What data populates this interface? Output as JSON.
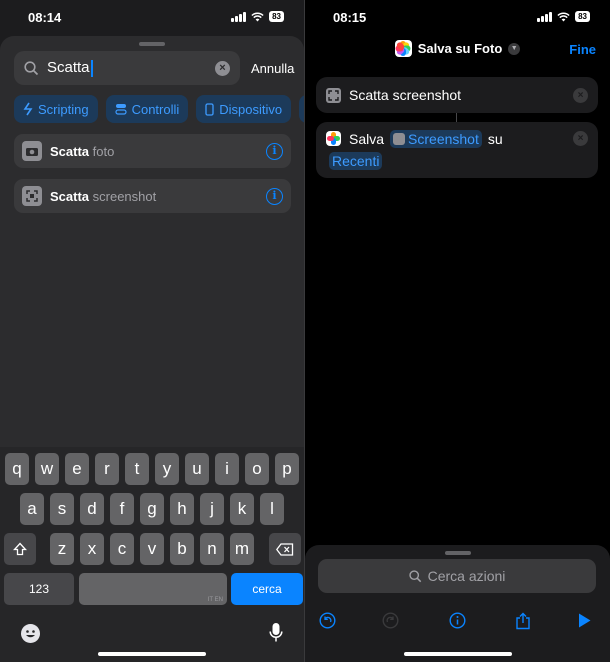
{
  "left": {
    "status": {
      "time": "08:14",
      "battery": "83"
    },
    "search": {
      "value": "Scatta",
      "cancel": "Annulla"
    },
    "chips": [
      {
        "label": "Scripting",
        "icon": "scripting-icon"
      },
      {
        "label": "Controlli",
        "icon": "controls-icon"
      },
      {
        "label": "Dispositivo",
        "icon": "device-icon"
      }
    ],
    "results": [
      {
        "bold": "Scatta",
        "rest": " foto",
        "icon": "camera-icon"
      },
      {
        "bold": "Scatta",
        "rest": " screenshot",
        "icon": "screenshot-icon"
      }
    ],
    "keyboard": {
      "row1": [
        "q",
        "w",
        "e",
        "r",
        "t",
        "y",
        "u",
        "i",
        "o",
        "p"
      ],
      "row2": [
        "a",
        "s",
        "d",
        "f",
        "g",
        "h",
        "j",
        "k",
        "l"
      ],
      "row3": [
        "z",
        "x",
        "c",
        "v",
        "b",
        "n",
        "m"
      ],
      "numbers": "123",
      "search_key": "cerca",
      "space_hint": "IT EN"
    }
  },
  "right": {
    "status": {
      "time": "08:15",
      "battery": "83"
    },
    "nav": {
      "title": "Salva su Foto",
      "done": "Fine"
    },
    "action1": {
      "title": "Scatta screenshot"
    },
    "action2": {
      "verb": "Salva",
      "variable": "Screenshot",
      "preposition": "su",
      "album": "Recenti"
    },
    "search_placeholder": "Cerca azioni"
  }
}
